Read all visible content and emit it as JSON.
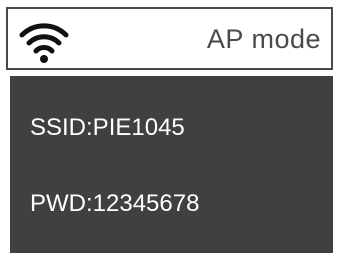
{
  "header": {
    "icon": "wifi-icon",
    "mode_label": "AP mode"
  },
  "network": {
    "ssid_text": "SSID:PIE1045",
    "password_text": "PWD:12345678"
  },
  "colors": {
    "panel_background": "#404040",
    "header_border": "#4a4a4a",
    "text_light": "#ffffff",
    "text_dark": "#4a4a4a"
  }
}
